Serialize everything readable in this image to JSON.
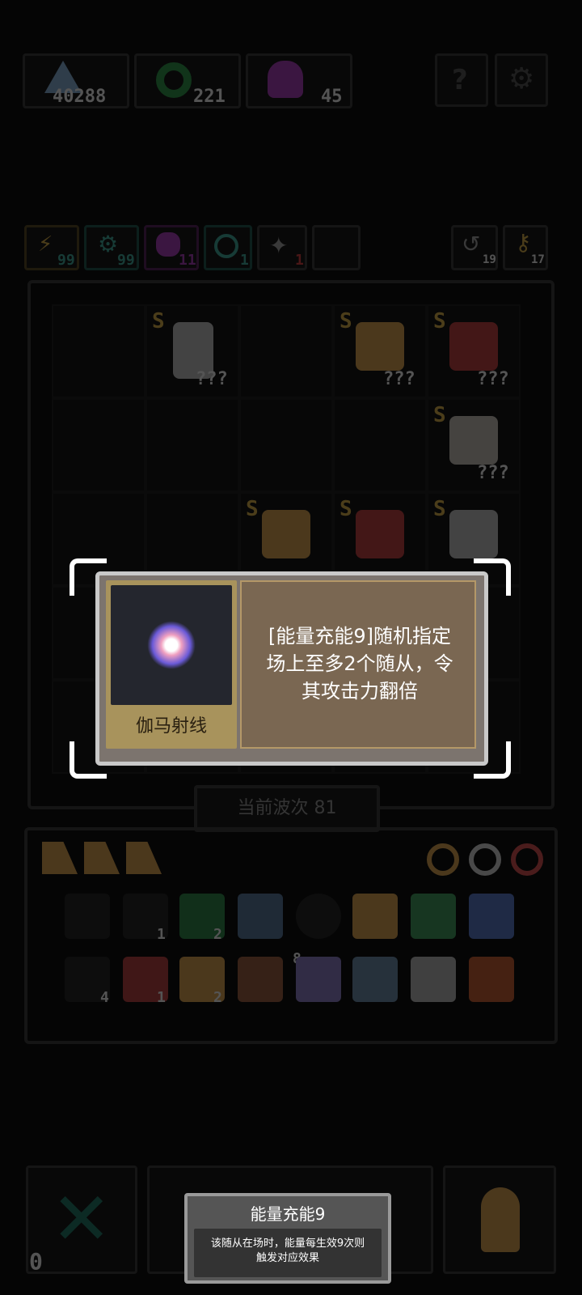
{
  "resources": [
    {
      "icon": "crystal-icon",
      "value": "40288",
      "color": "#8ab6e0"
    },
    {
      "icon": "ring-icon",
      "value": "221",
      "color": "#2e9a4a"
    },
    {
      "icon": "skull-icon",
      "value": "45",
      "color": "#b03cc4"
    }
  ],
  "stats": [
    {
      "icon": "attack-icon",
      "value": "99",
      "color": "#e3b64a"
    },
    {
      "icon": "gear-icon",
      "value": "99",
      "color": "#3fb0a0"
    },
    {
      "icon": "skull-icon",
      "value": "11",
      "color": "#b03cc4"
    },
    {
      "icon": "clock-icon",
      "value": "1",
      "color": "#3fb0a0"
    },
    {
      "icon": "energy-icon",
      "value": "1",
      "color": "#e04040"
    }
  ],
  "side_counters": [
    {
      "icon": "recycle-icon",
      "value": "19"
    },
    {
      "icon": "key-icon",
      "value": "17"
    }
  ],
  "board": {
    "unit_label": "???",
    "grade": "S"
  },
  "wave": {
    "label": "当前波次 81"
  },
  "tooltip": {
    "item_name": "伽马射线",
    "description_lines": [
      "[能量充能9]随机指定",
      "场上至多2个随从，令",
      "其攻击力翻倍"
    ]
  },
  "bag": {
    "counts": [
      "1",
      "2",
      "4",
      "1",
      "2",
      "8"
    ]
  },
  "bottom": {
    "left_counter": "0"
  },
  "popup": {
    "title": "能量充能9",
    "body_lines": [
      "该随从在场时，能量每生效9次则",
      "触发对应效果"
    ]
  }
}
